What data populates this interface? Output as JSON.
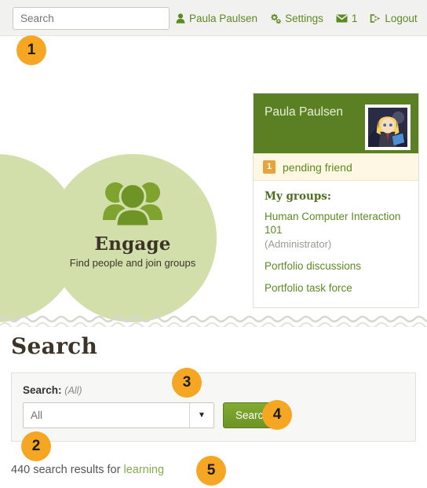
{
  "header": {
    "search_placeholder": "Search",
    "search_value": "",
    "nav": [
      {
        "label": "Paula Paulsen",
        "icon": "user-icon"
      },
      {
        "label": "Settings",
        "icon": "gears-icon"
      },
      {
        "label": "1",
        "icon": "envelope-icon"
      },
      {
        "label": "Logout",
        "icon": "logout-icon"
      }
    ]
  },
  "engage": {
    "title": "Engage",
    "subtitle": "Find people and join groups",
    "icon": "group-people-icon",
    "circle_color": "#d3dfaa"
  },
  "side_panel": {
    "user_name": "Paula Paulsen",
    "avatar_alt": "avatar",
    "notice": {
      "count": "1",
      "text": "pending friend"
    },
    "groups_title": "My groups:",
    "groups": [
      {
        "name": "Human Computer Interaction 101",
        "role": "(Administrator)"
      },
      {
        "name": "Portfolio discussions",
        "role": ""
      },
      {
        "name": "Portfolio task force",
        "role": ""
      }
    ],
    "header_color": "#5b8024",
    "notice_bg": "#fdf7e3"
  },
  "search_section": {
    "heading": "Search",
    "field_label": "Search:",
    "field_label_hint": "(All)",
    "select_value": "All",
    "select_options": [
      "All"
    ],
    "submit_label": "Search",
    "results_count_text": "440 search results for",
    "results_term": "learning"
  },
  "callouts": [
    {
      "number": "1"
    },
    {
      "number": "2"
    },
    {
      "number": "3"
    },
    {
      "number": "4"
    },
    {
      "number": "5"
    }
  ],
  "colors": {
    "accent_green": "#5d8a22",
    "badge_orange": "#f5a623",
    "panel_green": "#5b8024"
  }
}
